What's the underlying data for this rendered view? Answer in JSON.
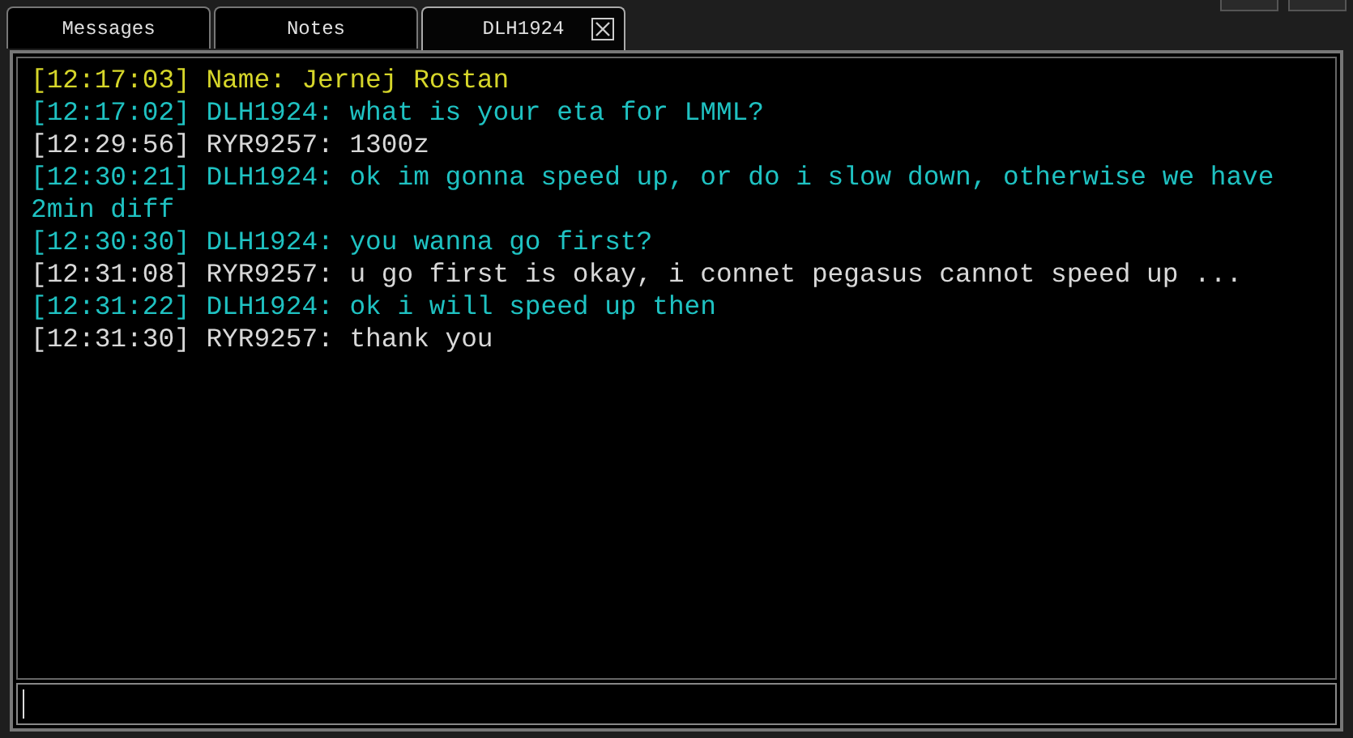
{
  "tabs": [
    {
      "label": "Messages",
      "selected": false,
      "closable": false
    },
    {
      "label": "Notes",
      "selected": false,
      "closable": false
    },
    {
      "label": "DLH1924",
      "selected": true,
      "closable": true
    }
  ],
  "messages": [
    {
      "kind": "info",
      "text": "[12:17:03] Name: Jernej Rostan"
    },
    {
      "kind": "remote",
      "text": "[12:17:02] DLH1924: what is your eta for LMML?"
    },
    {
      "kind": "local",
      "text": "[12:29:56] RYR9257: 1300z"
    },
    {
      "kind": "remote",
      "text": "[12:30:21] DLH1924: ok im gonna speed up, or do i slow down, otherwise we have 2min diff"
    },
    {
      "kind": "remote",
      "text": "[12:30:30] DLH1924: you wanna go first?"
    },
    {
      "kind": "local",
      "text": "[12:31:08] RYR9257: u go first is okay, i connet pegasus cannot speed up ..."
    },
    {
      "kind": "remote",
      "text": "[12:31:22] DLH1924: ok i will speed up then"
    },
    {
      "kind": "local",
      "text": "[12:31:30] RYR9257: thank you"
    }
  ]
}
